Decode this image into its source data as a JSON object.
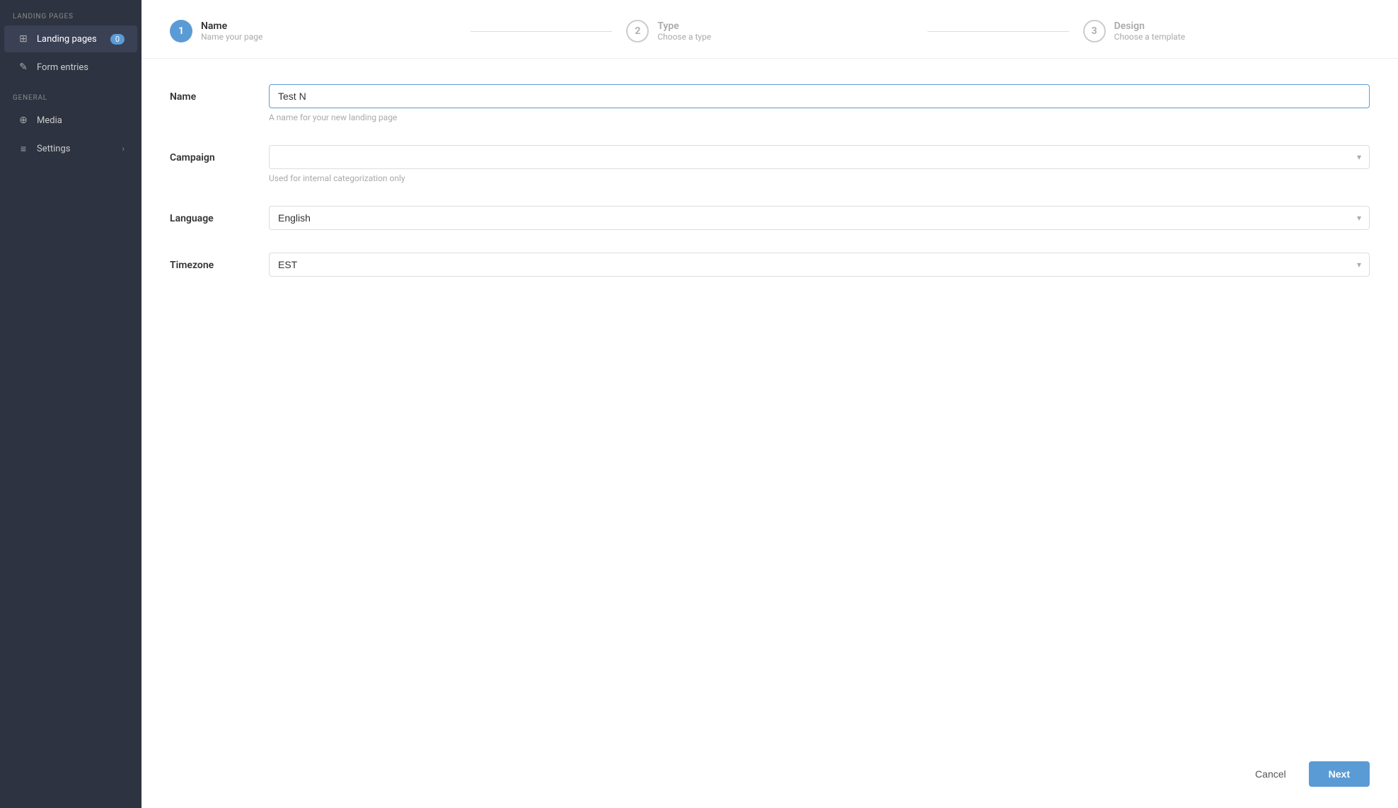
{
  "sidebar": {
    "sections": [
      {
        "label": "LANDING PAGES",
        "items": [
          {
            "id": "landing-pages",
            "label": "Landing pages",
            "icon": "⊞",
            "badge": "0",
            "active": true
          }
        ]
      },
      {
        "label": "",
        "items": [
          {
            "id": "form-entries",
            "label": "Form entries",
            "icon": "✎",
            "active": false
          }
        ]
      },
      {
        "label": "GENERAL",
        "items": [
          {
            "id": "media",
            "label": "Media",
            "icon": "⊕",
            "active": false
          },
          {
            "id": "settings",
            "label": "Settings",
            "icon": "≡",
            "chevron": "›",
            "active": false
          }
        ]
      }
    ]
  },
  "stepper": {
    "steps": [
      {
        "number": "1",
        "title": "Name",
        "subtitle": "Name your page",
        "active": true
      },
      {
        "number": "2",
        "title": "Type",
        "subtitle": "Choose a type",
        "active": false
      },
      {
        "number": "3",
        "title": "Design",
        "subtitle": "Choose a template",
        "active": false
      }
    ]
  },
  "form": {
    "name_label": "Name",
    "name_value": "Test N",
    "name_placeholder": "",
    "name_hint": "A name for your new landing page",
    "campaign_label": "Campaign",
    "campaign_hint": "Used for internal categorization only",
    "campaign_placeholder": "",
    "language_label": "Language",
    "language_value": "English",
    "timezone_label": "Timezone",
    "timezone_value": "EST"
  },
  "footer": {
    "cancel_label": "Cancel",
    "next_label": "Next"
  }
}
